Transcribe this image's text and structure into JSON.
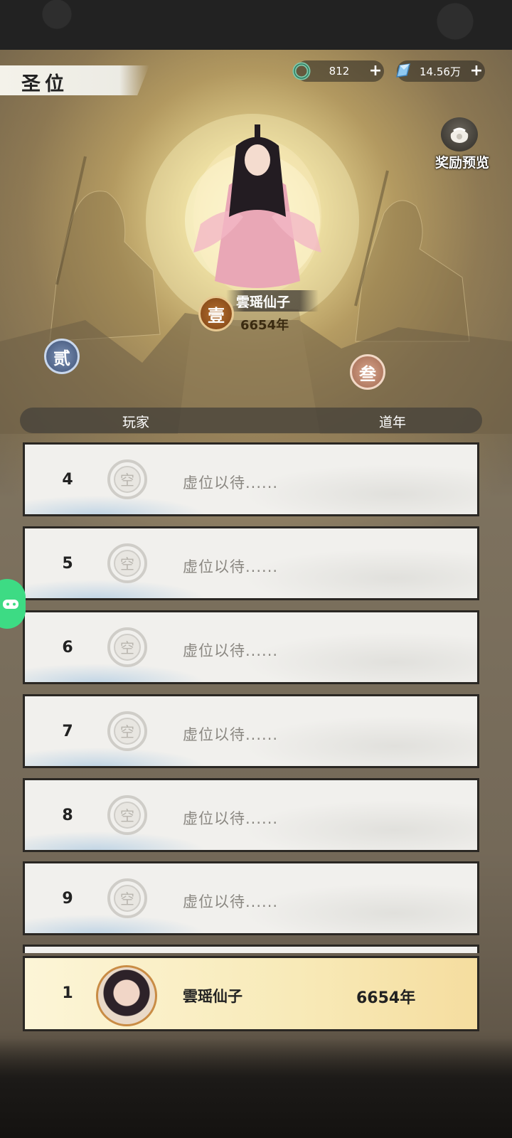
{
  "header": {
    "title": "圣位",
    "currency_jade": "812",
    "currency_crystal": "14.56万",
    "plus": "+"
  },
  "reward_preview": {
    "label": "奖励预览"
  },
  "podium": {
    "first": {
      "name": "雲瑶仙子",
      "years": "6654年",
      "seal": "壹"
    },
    "second": {
      "seal": "贰"
    },
    "third": {
      "seal": "叁"
    }
  },
  "table": {
    "col_player": "玩家",
    "col_years": "道年",
    "rows": [
      {
        "rank": "4",
        "empty_glyph": "空",
        "text": "虚位以待......"
      },
      {
        "rank": "5",
        "empty_glyph": "空",
        "text": "虚位以待......"
      },
      {
        "rank": "6",
        "empty_glyph": "空",
        "text": "虚位以待......"
      },
      {
        "rank": "7",
        "empty_glyph": "空",
        "text": "虚位以待......"
      },
      {
        "rank": "8",
        "empty_glyph": "空",
        "text": "虚位以待......"
      },
      {
        "rank": "9",
        "empty_glyph": "空",
        "text": "虚位以待......"
      }
    ]
  },
  "my_rank": {
    "rank": "1",
    "name": "雲瑶仙子",
    "years": "6654年"
  },
  "colors": {
    "accent_gold": "#c98c45",
    "side_button": "#3ddb84"
  }
}
